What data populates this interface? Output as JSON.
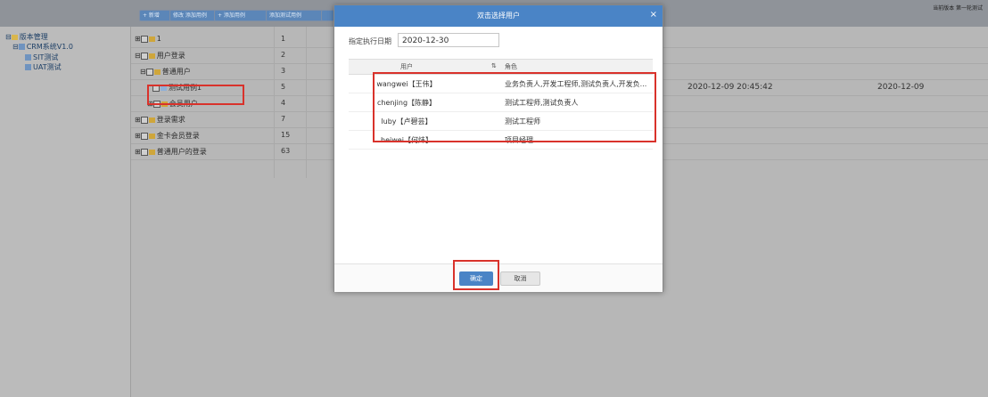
{
  "toolbar": {
    "buttons": [
      "+ 新增",
      "修改 添加用例",
      "+ 添加用例",
      "添加测试用例",
      ""
    ],
    "right_text": "当前版本 第一轮测试"
  },
  "sidebar": {
    "items": [
      {
        "label": "版本管理"
      },
      {
        "label": "CRM系统V1.0"
      },
      {
        "label": "SIT测试"
      },
      {
        "label": "UAT测试"
      }
    ]
  },
  "table": {
    "rows": [
      {
        "name": "1",
        "num": "1"
      },
      {
        "name": "用户登录",
        "num": "2"
      },
      {
        "name": "普通用户",
        "num": "3"
      },
      {
        "name": "测试用例1",
        "num": "5"
      },
      {
        "name": "会员用户",
        "num": "4"
      },
      {
        "name": "登录需求",
        "num": "7"
      },
      {
        "name": "金卡会员登录",
        "num": "15"
      },
      {
        "name": "普通用户的登录",
        "num": "63"
      }
    ],
    "selected_row_datetime": "2020-12-09 20:45:42",
    "selected_row_date": "2020-12-09"
  },
  "dialog": {
    "title": "双击选择用户",
    "close": "×",
    "date_label": "指定执行日期",
    "date_value": "2020-12-30",
    "col_user": "用户",
    "col_role": "角色",
    "col_role_icon": "⇅",
    "rows": [
      {
        "user": "wangwei【王伟】",
        "role": "业务负责人,开发工程师,测试负责人,开发负..."
      },
      {
        "user": "chenjing【陈静】",
        "role": "测试工程师,测试负责人"
      },
      {
        "user": "luby【卢碧芸】",
        "role": "测试工程师"
      },
      {
        "user": "heiwei【何炜】",
        "role": "项目经理"
      }
    ],
    "ok": "确定",
    "cancel": "取消"
  },
  "colors": {
    "accent": "#4a84c6",
    "highlight": "#d9322b"
  }
}
